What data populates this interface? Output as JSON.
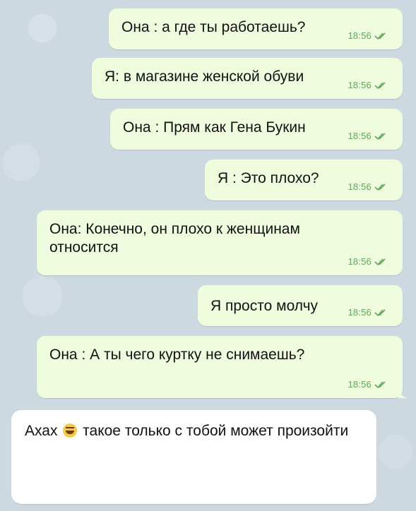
{
  "messages": [
    {
      "text": "Она :  а где ты работаешь?",
      "time": "18:56"
    },
    {
      "text": "Я:  в магазине женской обуви",
      "time": "18:56"
    },
    {
      "text": "Она :  Прям как Гена Букин",
      "time": "18:56"
    },
    {
      "text": "Я : Это плохо?",
      "time": "18:56"
    },
    {
      "text": "Она:  Конечно, он плохо к женщинам относится",
      "time": "18:56"
    },
    {
      "text": "Я просто молчу",
      "time": "18:56"
    },
    {
      "text": "Она : А ты чего куртку не снимаешь?",
      "time": "18:56"
    }
  ],
  "reply": {
    "text_before": "Ахах",
    "emoji": "laughing-tears-emoji",
    "text_after": " такое только с тобой может произойти"
  },
  "colors": {
    "outgoing_bubble": "#effdde",
    "incoming_bubble": "#ffffff",
    "timestamp": "#5fa759",
    "background": "#cdd9e0"
  }
}
